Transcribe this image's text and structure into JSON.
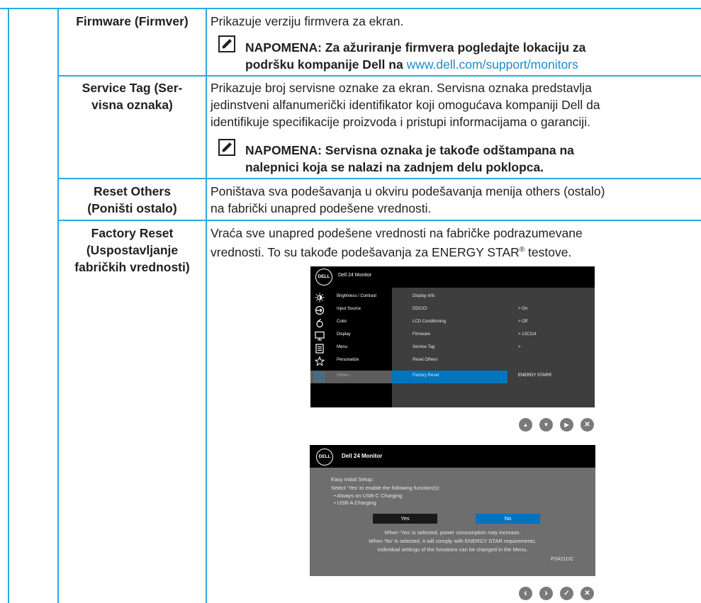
{
  "rows": [
    {
      "label": "Firmware (Firmver)",
      "text": "Prikazuje verziju firmvera za ekran.",
      "note_prefix": "NAPOMENA: Za ažuriranje firmvera pogledajte lokaciju za",
      "note_line2": "podršku kompanije Dell na",
      "note_link": "www.dell.com/support/monitors"
    },
    {
      "label_line1": "Service Tag (Ser-",
      "label_line2": "visna oznaka)",
      "text_line1": "Prikazuje broj servisne oznake za ekran. Servisna oznaka predstavlja",
      "text_line2": "jedinstveni alfanumerički identifikator koji omogućava kompaniji Dell da",
      "text_line3": "identifikuje specifikacije proizvoda i pristupi informacijama o garanciji.",
      "note_line1": "NAPOMENA: Servisna oznaka je takođe odštampana na",
      "note_line2": "nalepnici koja se nalazi na zadnjem delu poklopca."
    },
    {
      "label_line1": "Reset Others",
      "label_line2": "(Poništi ostalo)",
      "text_line1": "Poništava sva podešavanja u okviru podešavanja menija others (ostalo)",
      "text_line2": "na fabrički unapred podešene vrednosti."
    },
    {
      "label_line1": "Factory Reset",
      "label_line2": "(Uspostavljanje",
      "label_line3": "fabričkih vrednosti)",
      "text_line1": "Vraća sve unapred podešene vrednosti na fabričke podrazumevane",
      "text_line2_a": "vrednosti. To su takođe podešavanja za ENERGY STAR",
      "text_line2_sup": "®",
      "text_line2_b": " testove."
    }
  ],
  "osd": {
    "logo": "DELL",
    "title": "Dell 24 Monitor",
    "menu": [
      {
        "icon": "brightness-icon",
        "label": "Brightness / Contrast"
      },
      {
        "icon": "input-source-icon",
        "label": "Input Source"
      },
      {
        "icon": "color-icon",
        "label": "Color"
      },
      {
        "icon": "display-icon",
        "label": "Display"
      },
      {
        "icon": "menu-icon",
        "label": "Menu"
      },
      {
        "icon": "personalize-icon",
        "label": "Personalize"
      },
      {
        "icon": "others-icon",
        "label": "Others"
      }
    ],
    "settings": [
      {
        "label": "Display Info",
        "value": ""
      },
      {
        "label": "DDC/CI",
        "value": ">  On"
      },
      {
        "label": "LCD Conditioning",
        "value": ">  Off"
      },
      {
        "label": "Firmware",
        "value": ">  13C114"
      },
      {
        "label": "Service Tag",
        "value": ">"
      },
      {
        "label": "Reset Others",
        "value": ""
      },
      {
        "label": "Factory Reset",
        "value": "ENERGY STAR®"
      }
    ],
    "nav": [
      "▲",
      "▼",
      "▶",
      "✕"
    ]
  },
  "dialog": {
    "logo": "DELL",
    "title": "Dell 24 Monitor",
    "line1": "Easy Initial Setup:",
    "line2": "Select 'Yes' to enable the following function(s):",
    "bullet1": "• Always on USB-C Charging",
    "bullet2": "• USB-A Charging",
    "yes": "Yes",
    "no": "No",
    "info1": "When 'Yes' is selected, power consumption may increase.",
    "info2": "When 'No' is selected, it will comply with ENERGY STAR requirements.",
    "info3": "Individual settings of the funotions can be changed in the Menu.",
    "model": "P2421DC",
    "nav": [
      "‹",
      "›",
      "✓",
      "✕"
    ]
  },
  "colors": {
    "rule": "#29aae1",
    "link": "#1c8ccc",
    "osd_highlight": "#0075be"
  }
}
